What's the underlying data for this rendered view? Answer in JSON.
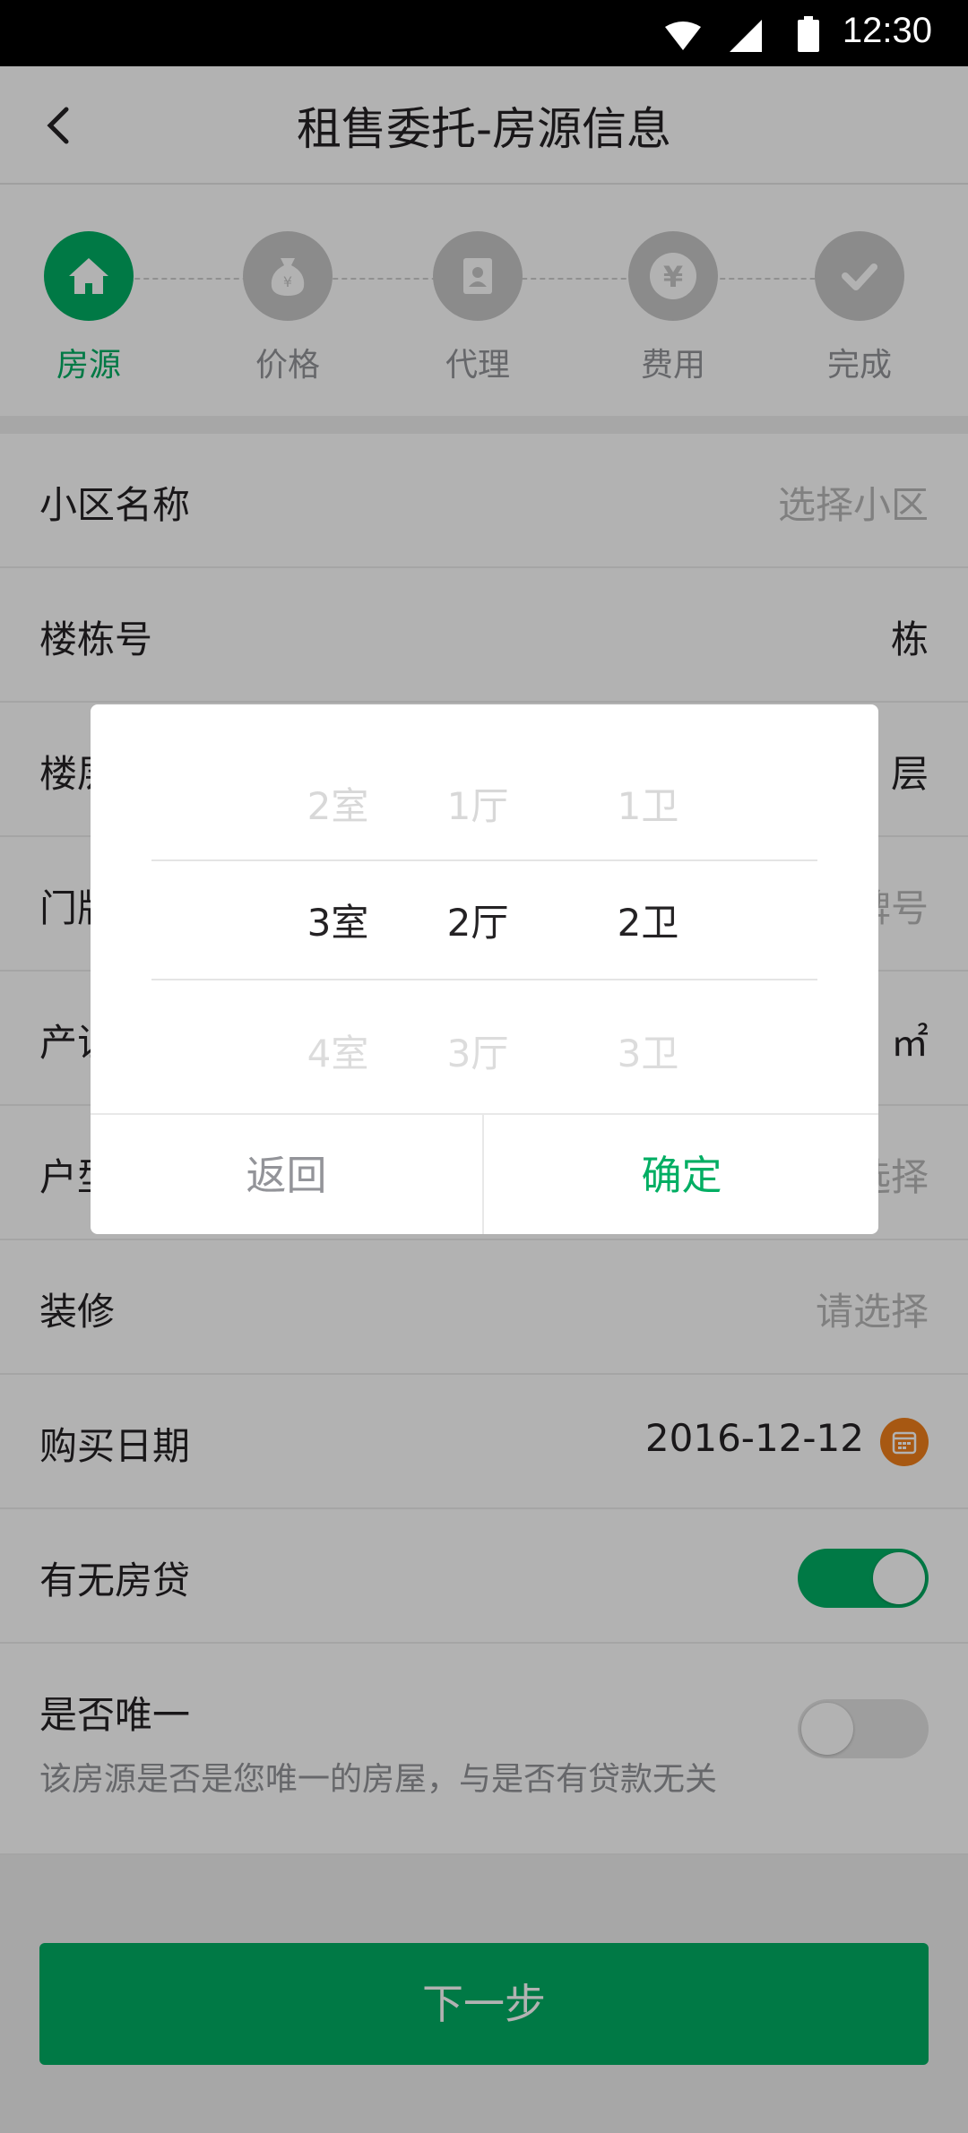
{
  "status_bar": {
    "time": "12:30"
  },
  "header": {
    "title": "租售委托-房源信息"
  },
  "steps": [
    {
      "label": "房源",
      "icon": "house-icon",
      "active": true
    },
    {
      "label": "价格",
      "icon": "money-bag-icon",
      "active": false
    },
    {
      "label": "代理",
      "icon": "contact-book-icon",
      "active": false
    },
    {
      "label": "费用",
      "icon": "yen-icon",
      "active": false
    },
    {
      "label": "完成",
      "icon": "check-icon",
      "active": false
    }
  ],
  "form": {
    "community": {
      "label": "小区名称",
      "placeholder": "选择小区"
    },
    "building": {
      "label": "楼栋号",
      "value": "栋"
    },
    "floor": {
      "label": "楼层",
      "value": "层"
    },
    "door": {
      "label": "门牌号",
      "placeholder": "门牌号"
    },
    "area": {
      "label": "产证面积",
      "unit": "㎡"
    },
    "layout": {
      "label": "户型",
      "placeholder": "请选择"
    },
    "decoration": {
      "label": "装修",
      "placeholder": "请选择"
    },
    "purchase_date": {
      "label": "购买日期",
      "value": "2016-12-12"
    },
    "mortgage": {
      "label": "有无房贷",
      "on": true
    },
    "unique": {
      "label": "是否唯一",
      "hint": "该房源是否是您唯一的房屋，与是否有贷款无关",
      "on": false
    }
  },
  "next_button": "下一步",
  "picker": {
    "columns": [
      {
        "above": "2室",
        "selected": "3室",
        "below": "4室"
      },
      {
        "above": "1厅",
        "selected": "2厅",
        "below": "3厅"
      },
      {
        "above": "1卫",
        "selected": "2卫",
        "below": "3卫"
      }
    ],
    "cancel": "返回",
    "confirm": "确定"
  },
  "colors": {
    "accent": "#00ae63",
    "text": "#242224",
    "muted": "#939499",
    "calendar": "#f07f1a"
  }
}
